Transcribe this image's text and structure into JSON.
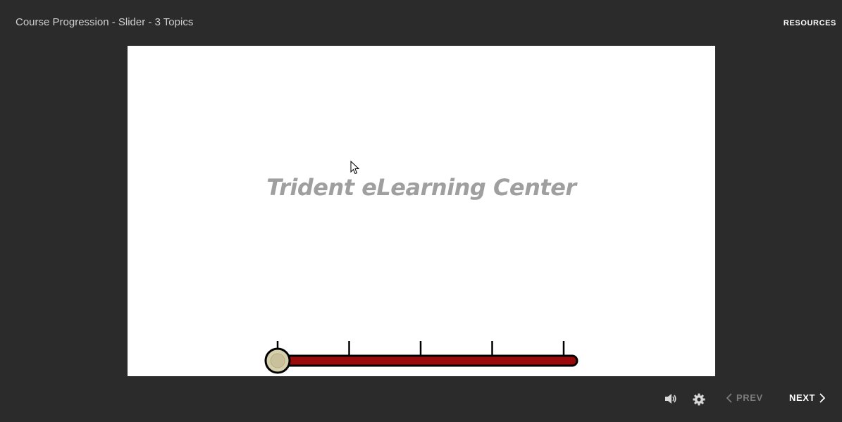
{
  "header": {
    "title": "Course Progression - Slider - 3 Topics",
    "resources_label": "RESOURCES"
  },
  "slide": {
    "title": "Trident eLearning Center",
    "slider": {
      "tick_count": 5,
      "value": 0,
      "track_color": "#9b0a0a",
      "thumb_color": "#d6cfab"
    }
  },
  "footer": {
    "volume_icon": "volume-icon",
    "settings_icon": "gear-icon",
    "prev_label": "PREV",
    "next_label": "NEXT",
    "prev_enabled": false
  },
  "colors": {
    "background": "#2b2b2b",
    "stage": "#ffffff",
    "title_text": "#9f9f9f"
  }
}
